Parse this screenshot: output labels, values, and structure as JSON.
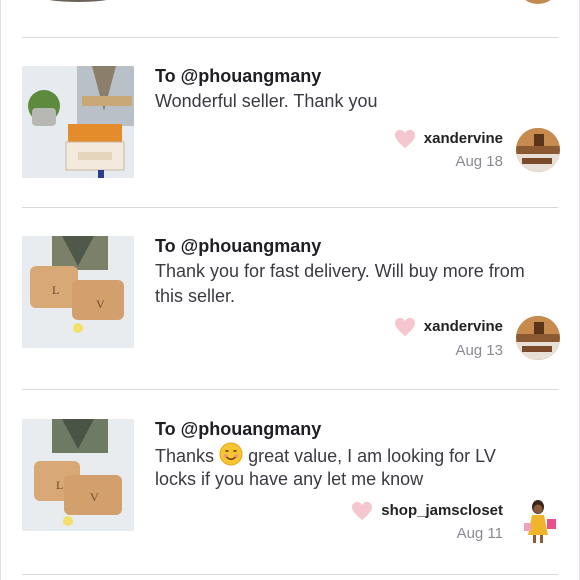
{
  "reviews": [
    {
      "to": "To @phouangmany",
      "message": "Wonderful seller. Thank you",
      "username": "xandervine",
      "date": "Aug 18"
    },
    {
      "to": "To @phouangmany",
      "message_line1": "Thank you for fast delivery. Will buy more from",
      "message_line2": "this seller.",
      "username": "xandervine",
      "date": "Aug 13"
    },
    {
      "to": "To @phouangmany",
      "message_before_emoji": "Thanks",
      "message_after_emoji": "great value, I am looking for LV",
      "message_line2": "locks if you have any let me know",
      "username": "shop_jamscloset",
      "date": "Aug 11"
    }
  ],
  "icons": {
    "like": "heart-icon",
    "emoji": "smiling-face-emoji"
  },
  "colors": {
    "heart": "#f4c6cd",
    "divider": "#d9d9d9"
  }
}
